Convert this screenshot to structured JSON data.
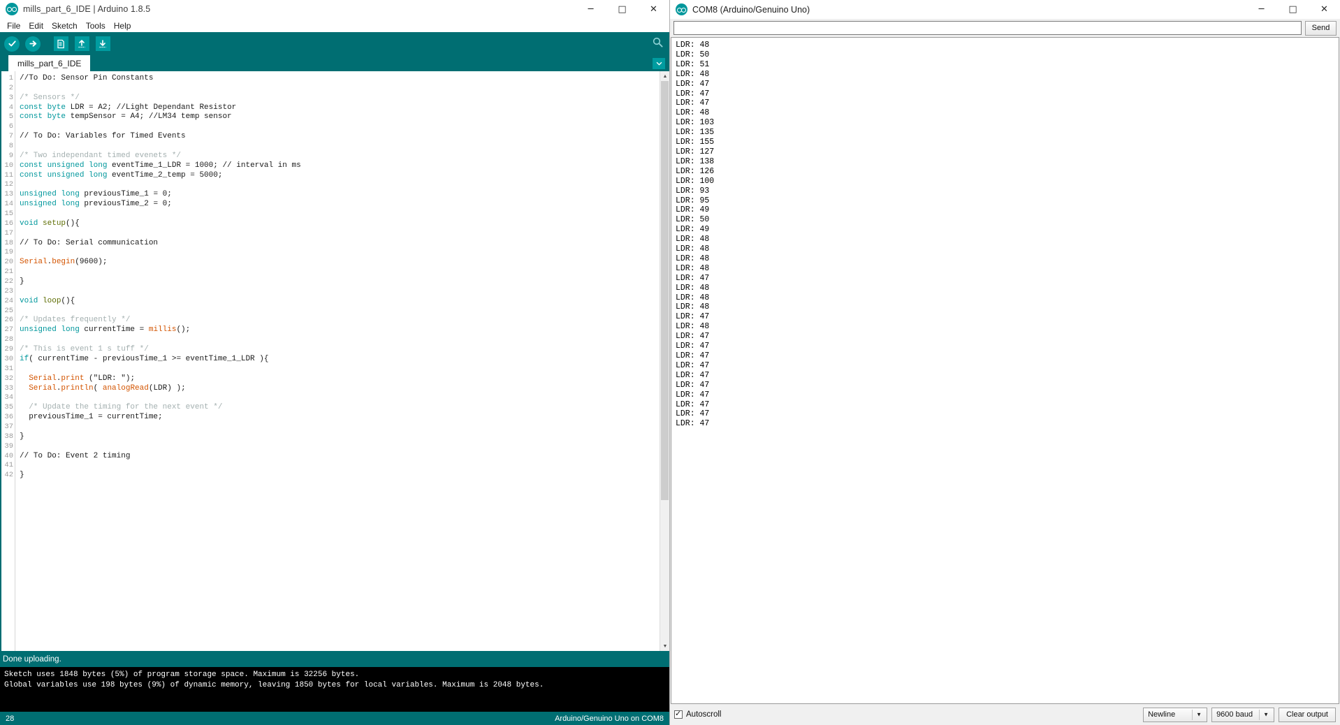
{
  "ide": {
    "window_title": "mills_part_6_IDE | Arduino 1.8.5",
    "logo_icon": "arduino-logo-icon",
    "window_controls": {
      "minimize": "─",
      "maximize": "□",
      "close": "✕"
    },
    "menu": [
      "File",
      "Edit",
      "Sketch",
      "Tools",
      "Help"
    ],
    "toolbar": {
      "verify": "verify-checkmark-icon",
      "upload": "upload-arrow-icon",
      "new": "new-file-icon",
      "open": "open-folder-up-arrow-icon",
      "save": "save-down-arrow-icon",
      "serial_monitor": "serial-monitor-magnifier-icon"
    },
    "tab_label": "mills_part_6_IDE",
    "tab_dropdown_icon": "chevron-down-icon",
    "code_lines": [
      {
        "n": 1,
        "tokens": [
          {
            "t": "//To Do: Sensor Pin Constants",
            "c": "pl"
          }
        ]
      },
      {
        "n": 2,
        "tokens": []
      },
      {
        "n": 3,
        "tokens": [
          {
            "t": "/* Sensors */",
            "c": "cm"
          }
        ]
      },
      {
        "n": 4,
        "tokens": [
          {
            "t": "const byte ",
            "c": "kw"
          },
          {
            "t": "LDR = A2; ",
            "c": "pl"
          },
          {
            "t": "//Light Dependant Resistor",
            "c": "pl"
          }
        ]
      },
      {
        "n": 5,
        "tokens": [
          {
            "t": "const byte ",
            "c": "kw"
          },
          {
            "t": "tempSensor = A4; ",
            "c": "pl"
          },
          {
            "t": "//LM34 temp sensor",
            "c": "pl"
          }
        ]
      },
      {
        "n": 6,
        "tokens": []
      },
      {
        "n": 7,
        "tokens": [
          {
            "t": "// To Do: Variables for Timed Events",
            "c": "pl"
          }
        ]
      },
      {
        "n": 8,
        "tokens": []
      },
      {
        "n": 9,
        "tokens": [
          {
            "t": "/* Two independant timed evenets */",
            "c": "cm"
          }
        ]
      },
      {
        "n": 10,
        "tokens": [
          {
            "t": "const unsigned long ",
            "c": "kw"
          },
          {
            "t": "eventTime_1_LDR = 1000; // interval in ms",
            "c": "pl"
          }
        ]
      },
      {
        "n": 11,
        "tokens": [
          {
            "t": "const unsigned long ",
            "c": "kw"
          },
          {
            "t": "eventTime_2_temp = 5000;",
            "c": "pl"
          }
        ]
      },
      {
        "n": 12,
        "tokens": []
      },
      {
        "n": 13,
        "tokens": [
          {
            "t": "unsigned long ",
            "c": "kw"
          },
          {
            "t": "previousTime_1 = 0;",
            "c": "pl"
          }
        ]
      },
      {
        "n": 14,
        "tokens": [
          {
            "t": "unsigned long ",
            "c": "kw"
          },
          {
            "t": "previousTime_2 = 0;",
            "c": "pl"
          }
        ]
      },
      {
        "n": 15,
        "tokens": []
      },
      {
        "n": 16,
        "tokens": [
          {
            "t": "void ",
            "c": "kw"
          },
          {
            "t": "setup",
            "c": "kw2"
          },
          {
            "t": "(){",
            "c": "pl"
          }
        ]
      },
      {
        "n": 17,
        "tokens": []
      },
      {
        "n": 18,
        "tokens": [
          {
            "t": "// To Do: Serial communication",
            "c": "pl"
          }
        ]
      },
      {
        "n": 19,
        "tokens": []
      },
      {
        "n": 20,
        "tokens": [
          {
            "t": "Serial",
            "c": "fn"
          },
          {
            "t": ".",
            "c": "pl"
          },
          {
            "t": "begin",
            "c": "fn"
          },
          {
            "t": "(9600);",
            "c": "pl"
          }
        ]
      },
      {
        "n": 21,
        "tokens": []
      },
      {
        "n": 22,
        "tokens": [
          {
            "t": "}",
            "c": "pl"
          }
        ]
      },
      {
        "n": 23,
        "tokens": []
      },
      {
        "n": 24,
        "tokens": [
          {
            "t": "void ",
            "c": "kw"
          },
          {
            "t": "loop",
            "c": "kw2"
          },
          {
            "t": "(){",
            "c": "pl"
          }
        ]
      },
      {
        "n": 25,
        "tokens": []
      },
      {
        "n": 26,
        "tokens": [
          {
            "t": "/* Updates frequently */",
            "c": "cm"
          }
        ]
      },
      {
        "n": 27,
        "tokens": [
          {
            "t": "unsigned long ",
            "c": "kw"
          },
          {
            "t": "currentTime = ",
            "c": "pl"
          },
          {
            "t": "millis",
            "c": "fn"
          },
          {
            "t": "();",
            "c": "pl"
          }
        ]
      },
      {
        "n": 28,
        "tokens": []
      },
      {
        "n": 29,
        "tokens": [
          {
            "t": "/* This is event 1 s tuff */",
            "c": "cm"
          }
        ]
      },
      {
        "n": 30,
        "tokens": [
          {
            "t": "if",
            "c": "kw"
          },
          {
            "t": "( currentTime - previousTime_1 >= eventTime_1_LDR ){",
            "c": "pl"
          }
        ]
      },
      {
        "n": 31,
        "tokens": []
      },
      {
        "n": 32,
        "tokens": [
          {
            "t": "  ",
            "c": "pl"
          },
          {
            "t": "Serial",
            "c": "fn"
          },
          {
            "t": ".",
            "c": "pl"
          },
          {
            "t": "print",
            "c": "fn"
          },
          {
            "t": " (\"LDR: \");",
            "c": "pl"
          }
        ]
      },
      {
        "n": 33,
        "tokens": [
          {
            "t": "  ",
            "c": "pl"
          },
          {
            "t": "Serial",
            "c": "fn"
          },
          {
            "t": ".",
            "c": "pl"
          },
          {
            "t": "println",
            "c": "fn"
          },
          {
            "t": "( ",
            "c": "pl"
          },
          {
            "t": "analogRead",
            "c": "fn"
          },
          {
            "t": "(LDR) );",
            "c": "pl"
          }
        ]
      },
      {
        "n": 34,
        "tokens": []
      },
      {
        "n": 35,
        "tokens": [
          {
            "t": "  /* Update the timing for the next event */",
            "c": "cm"
          }
        ]
      },
      {
        "n": 36,
        "tokens": [
          {
            "t": "  previousTime_1 = currentTime;",
            "c": "pl"
          }
        ]
      },
      {
        "n": 37,
        "tokens": []
      },
      {
        "n": 38,
        "tokens": [
          {
            "t": "}",
            "c": "pl"
          }
        ]
      },
      {
        "n": 39,
        "tokens": []
      },
      {
        "n": 40,
        "tokens": [
          {
            "t": "// To Do: Event 2 timing",
            "c": "pl"
          }
        ]
      },
      {
        "n": 41,
        "tokens": []
      },
      {
        "n": 42,
        "tokens": [
          {
            "t": "}",
            "c": "pl"
          }
        ]
      }
    ],
    "status_message": "Done uploading.",
    "console_lines": [
      "Sketch uses 1848 bytes (5%) of program storage space. Maximum is 32256 bytes.",
      "Global variables use 198 bytes (9%) of dynamic memory, leaving 1850 bytes for local variables. Maximum is 2048 bytes."
    ],
    "statusbar": {
      "line_number": "28",
      "board_info": "Arduino/Genuino Uno on COM8"
    }
  },
  "serial_monitor": {
    "window_title": "COM8 (Arduino/Genuino Uno)",
    "logo_icon": "arduino-logo-icon",
    "window_controls": {
      "minimize": "─",
      "maximize": "□",
      "close": "✕"
    },
    "send_input_value": "",
    "send_input_placeholder": "",
    "send_button": "Send",
    "output_lines": [
      "LDR: 48",
      "LDR: 50",
      "LDR: 51",
      "LDR: 48",
      "LDR: 47",
      "LDR: 47",
      "LDR: 47",
      "LDR: 48",
      "LDR: 103",
      "LDR: 135",
      "LDR: 155",
      "LDR: 127",
      "LDR: 138",
      "LDR: 126",
      "LDR: 100",
      "LDR: 93",
      "LDR: 95",
      "LDR: 49",
      "LDR: 50",
      "LDR: 49",
      "LDR: 48",
      "LDR: 48",
      "LDR: 48",
      "LDR: 48",
      "LDR: 47",
      "LDR: 48",
      "LDR: 48",
      "LDR: 48",
      "LDR: 47",
      "LDR: 48",
      "LDR: 47",
      "LDR: 47",
      "LDR: 47",
      "LDR: 47",
      "LDR: 47",
      "LDR: 47",
      "LDR: 47",
      "LDR: 47",
      "LDR: 47",
      "LDR: 47"
    ],
    "autoscroll_label": "Autoscroll",
    "autoscroll_checked": true,
    "line_ending_selected": "Newline",
    "baud_selected": "9600 baud",
    "clear_button": "Clear output",
    "chevron_icon": "chevron-down-icon"
  },
  "colors": {
    "teal": "#006e72",
    "teal_light": "#009ca0",
    "console_bg": "#000000",
    "keyword": "#00979c",
    "function": "#d35400",
    "comment": "#a4b0b0"
  }
}
